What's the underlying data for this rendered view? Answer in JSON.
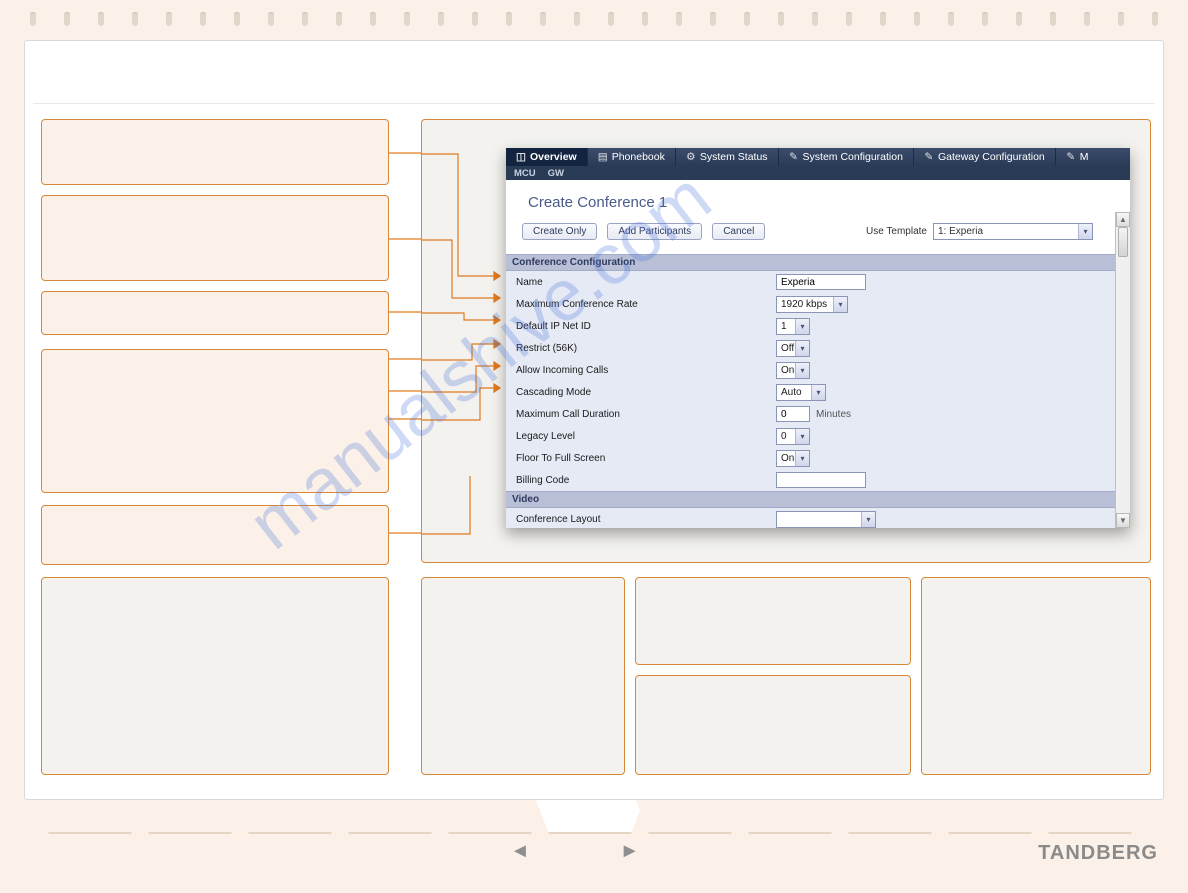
{
  "brand": "TANDBERG",
  "watermark": "manualshive.com",
  "app": {
    "tabs": [
      {
        "label": "Overview",
        "active": true,
        "icon": "briefcase-icon"
      },
      {
        "label": "Phonebook",
        "active": false,
        "icon": "book-icon"
      },
      {
        "label": "System Status",
        "active": false,
        "icon": "gear-icon"
      },
      {
        "label": "System Configuration",
        "active": false,
        "icon": "wrench-icon"
      },
      {
        "label": "Gateway Configuration",
        "active": false,
        "icon": "wrench-icon"
      },
      {
        "label": "M",
        "active": false,
        "icon": "tool-icon"
      }
    ],
    "subnav": {
      "items": [
        "MCU",
        "GW"
      ]
    },
    "title": "Create Conference 1",
    "buttons": {
      "create_only": "Create Only",
      "add_participants": "Add Participants",
      "cancel": "Cancel"
    },
    "use_template": {
      "label": "Use Template",
      "selected": "1:   Experia"
    },
    "sections": {
      "conference_config": {
        "header": "Conference Configuration",
        "name": {
          "label": "Name",
          "value": "Experia"
        },
        "max_rate": {
          "label": "Maximum Conference Rate",
          "value": "1920 kbps"
        },
        "default_ip_net_id": {
          "label": "Default IP Net ID",
          "value": "1"
        },
        "restrict_56k": {
          "label": "Restrict (56K)",
          "value": "Off"
        },
        "allow_incoming": {
          "label": "Allow Incoming Calls",
          "value": "On"
        },
        "cascading_mode": {
          "label": "Cascading Mode",
          "value": "Auto"
        },
        "max_call_duration": {
          "label": "Maximum Call Duration",
          "value": "0",
          "unit": "Minutes"
        },
        "legacy_level": {
          "label": "Legacy Level",
          "value": "0"
        },
        "floor_fullscreen": {
          "label": "Floor To Full Screen",
          "value": "On"
        },
        "billing_code": {
          "label": "Billing Code",
          "value": ""
        }
      },
      "video": {
        "header": "Video",
        "conference_layout": {
          "label": "Conference Layout",
          "value": ""
        }
      }
    }
  }
}
